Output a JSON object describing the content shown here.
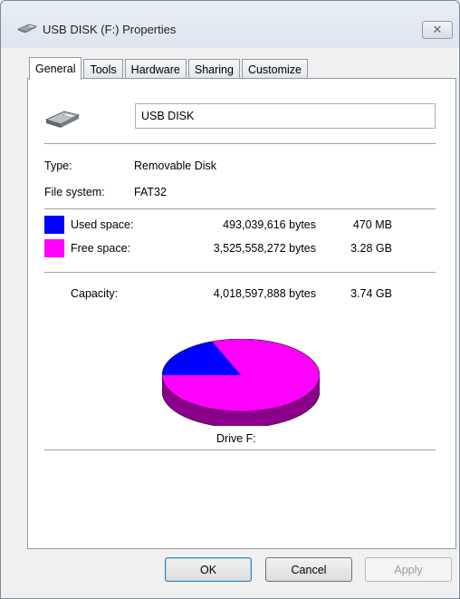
{
  "window": {
    "title": "USB DISK (F:) Properties",
    "close_glyph": "✕"
  },
  "tabs": [
    {
      "label": "General",
      "active": true
    },
    {
      "label": "Tools",
      "active": false
    },
    {
      "label": "Hardware",
      "active": false
    },
    {
      "label": "Sharing",
      "active": false
    },
    {
      "label": "Customize",
      "active": false
    }
  ],
  "general": {
    "drive_name": "USB DISK",
    "type_label": "Type:",
    "type_value": "Removable Disk",
    "fs_label": "File system:",
    "fs_value": "FAT32",
    "used": {
      "label": "Used space:",
      "bytes": "493,039,616 bytes",
      "size": "470 MB",
      "color": "#0000ff"
    },
    "free": {
      "label": "Free space:",
      "bytes": "3,525,558,272 bytes",
      "size": "3.28 GB",
      "color": "#ff00ff"
    },
    "capacity": {
      "label": "Capacity:",
      "bytes": "4,018,597,888 bytes",
      "size": "3.74 GB"
    },
    "drive_caption": "Drive F:"
  },
  "buttons": {
    "ok": "OK",
    "cancel": "Cancel",
    "apply": "Apply"
  }
}
